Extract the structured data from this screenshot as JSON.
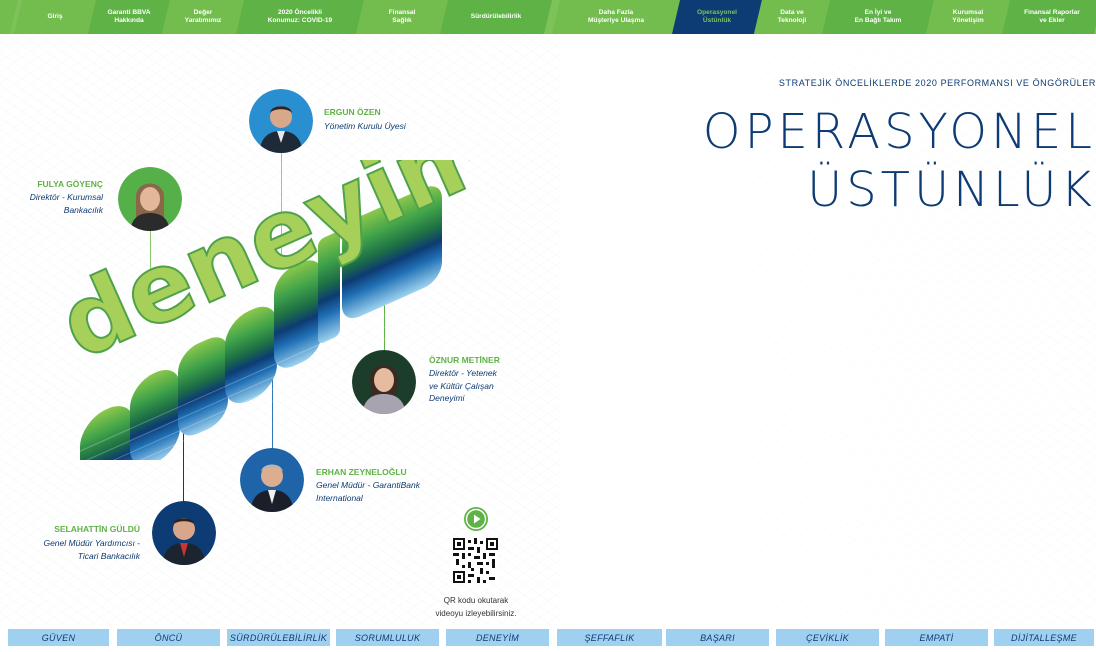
{
  "nav": {
    "tabs": [
      {
        "label": "Giriş"
      },
      {
        "label": "Garanti BBVA\nHakkında"
      },
      {
        "label": "Değer\nYaratımımız"
      },
      {
        "label": "2020 Öncelikli\nKonumuz: COVID-19"
      },
      {
        "label": "Finansal\nSağlık"
      },
      {
        "label": "Sürdürülebilirlik"
      },
      {
        "label": "Daha Fazla\nMüşteriye Ulaşma"
      },
      {
        "label": "Operasyonel\nÜstünlük"
      },
      {
        "label": "Data ve\nTeknoloji"
      },
      {
        "label": "En İyi ve\nEn Bağlı Takım"
      },
      {
        "label": "Kurumsal\nYönetişim"
      },
      {
        "label": "Finansal Raporlar\nve Ekler"
      }
    ],
    "active_index": 7
  },
  "header": {
    "kicker": "STRATEJİK ÖNCELİKLERDE 2020 PERFORMANSI VE ÖNGÖRÜLER",
    "title_line1": "OPERASYONEL",
    "title_line2": "ÜSTÜNLÜK"
  },
  "artwork": {
    "word": "deneyim"
  },
  "people": [
    {
      "name": "ERGUN ÖZEN",
      "role": "Yönetim Kurulu Üyesi"
    },
    {
      "name": "FULYA GÖYENÇ",
      "role": "Direktör - Kurumsal\nBankacılık"
    },
    {
      "name": "ÖZNUR METİNER",
      "role": "Direktör - Yetenek\nve Kültür Çalışan\nDeneyimi"
    },
    {
      "name": "ERHAN ZEYNELOĞLU",
      "role": "Genel Müdür - GarantiBank\nInternational"
    },
    {
      "name": "SELAHATTİN GÜLDÜ",
      "role": "Genel Müdür Yardımcısı -\nTicari Bankacılık"
    }
  ],
  "qr": {
    "caption": "QR kodu okutarak\nvideoyu izleyebilirsiniz."
  },
  "values_bar": [
    "GÜVEN",
    "ÖNCÜ",
    "SÜRDÜRÜLEBİLİRLİK",
    "SORUMLULUK",
    "DENEYİM",
    "ŞEFFAFLIK",
    "BAŞARI",
    "ÇEVİKLİK",
    "EMPATİ",
    "DİJİTALLEŞME"
  ],
  "colors": {
    "navy": "#0d3b73",
    "green": "#5fb246",
    "light_blue": "#9fd0ef"
  }
}
